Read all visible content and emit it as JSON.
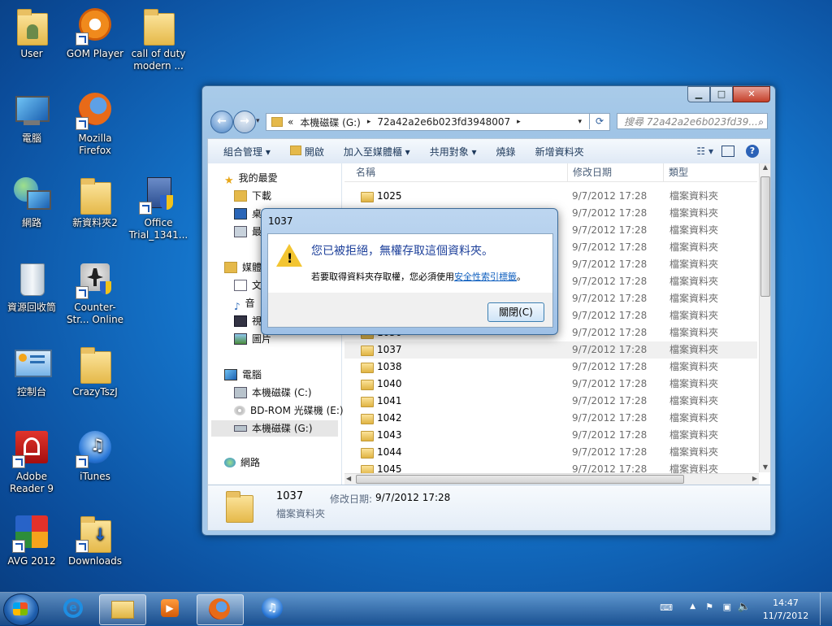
{
  "desktop": {
    "icons": [
      {
        "label": "User"
      },
      {
        "label": "GOM Player"
      },
      {
        "label": "call of duty modern ..."
      },
      {
        "label": "電腦"
      },
      {
        "label": "Mozilla Firefox"
      },
      {
        "label": "網路"
      },
      {
        "label": "新資料夾2"
      },
      {
        "label": "Office Trial_1341..."
      },
      {
        "label": "資源回收筒"
      },
      {
        "label": "Counter-Str... Online"
      },
      {
        "label": "控制台"
      },
      {
        "label": "CrazyTszJ"
      },
      {
        "label": "Adobe Reader 9"
      },
      {
        "label": "iTunes"
      },
      {
        "label": "AVG 2012"
      },
      {
        "label": "Downloads"
      }
    ]
  },
  "explorer": {
    "address": {
      "prefix": "«",
      "crumb1": "本機磁碟 (G:)",
      "crumb2": "72a42a2e6b023fd3948007",
      "sep": "▸"
    },
    "search_placeholder": "搜尋 72a42a2e6b023fd39...",
    "toolbar": [
      "組合管理 ▾",
      "開啟",
      "加入至媒體櫃 ▾",
      "共用對象 ▾",
      "燒錄",
      "新增資料夾"
    ],
    "nav": {
      "favorites": "我的最愛",
      "downloads": "下載",
      "desktop": "桌",
      "recent": "最",
      "libraries": "媒體",
      "docs": "文",
      "music": "音",
      "video": "視",
      "pictures": "圖片",
      "computer": "電腦",
      "c_drive": "本機磁碟 (C:)",
      "e_drive": "BD-ROM 光碟機 (E:)",
      "g_drive": "本機磁碟 (G:)",
      "network": "網路"
    },
    "columns": {
      "name": "名稱",
      "date": "修改日期",
      "type": "類型"
    },
    "files": [
      {
        "name": "1025",
        "date": "9/7/2012 17:28",
        "type": "檔案資料夾"
      },
      {
        "name": "",
        "date": "9/7/2012 17:28",
        "type": "檔案資料夾"
      },
      {
        "name": "",
        "date": "9/7/2012 17:28",
        "type": "檔案資料夾"
      },
      {
        "name": "",
        "date": "9/7/2012 17:28",
        "type": "檔案資料夾"
      },
      {
        "name": "",
        "date": "9/7/2012 17:28",
        "type": "檔案資料夾"
      },
      {
        "name": "",
        "date": "9/7/2012 17:28",
        "type": "檔案資料夾"
      },
      {
        "name": "",
        "date": "9/7/2012 17:28",
        "type": "檔案資料夾"
      },
      {
        "name": "",
        "date": "9/7/2012 17:28",
        "type": "檔案資料夾"
      },
      {
        "name": "1036",
        "date": "9/7/2012 17:28",
        "type": "檔案資料夾"
      },
      {
        "name": "1037",
        "date": "9/7/2012 17:28",
        "type": "檔案資料夾"
      },
      {
        "name": "1038",
        "date": "9/7/2012 17:28",
        "type": "檔案資料夾"
      },
      {
        "name": "1040",
        "date": "9/7/2012 17:28",
        "type": "檔案資料夾"
      },
      {
        "name": "1041",
        "date": "9/7/2012 17:28",
        "type": "檔案資料夾"
      },
      {
        "name": "1042",
        "date": "9/7/2012 17:28",
        "type": "檔案資料夾"
      },
      {
        "name": "1043",
        "date": "9/7/2012 17:28",
        "type": "檔案資料夾"
      },
      {
        "name": "1044",
        "date": "9/7/2012 17:28",
        "type": "檔案資料夾"
      },
      {
        "name": "1045",
        "date": "9/7/2012 17:28",
        "type": "檔案資料夾"
      }
    ],
    "details": {
      "name": "1037",
      "modified_label": "修改日期:",
      "modified": "9/7/2012 17:28",
      "type": "檔案資料夾"
    }
  },
  "dialog": {
    "title": "1037",
    "heading": "您已被拒絕，無權存取這個資料夾。",
    "message_pre": "若要取得資料夾存取權，您必須使用",
    "message_link": "安全性索引標籤",
    "message_post": "。",
    "close_button": "關閉(C)"
  },
  "taskbar": {
    "time": "14:47",
    "date": "11/7/2012"
  }
}
